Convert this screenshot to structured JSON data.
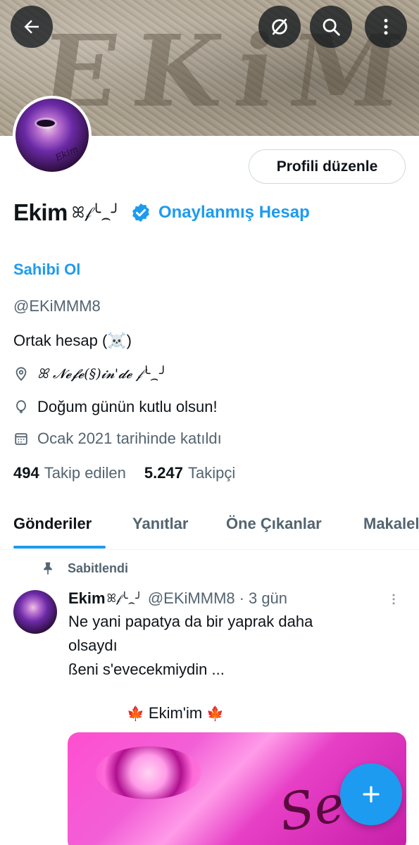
{
  "banner": {
    "text": "EKiM"
  },
  "header_buttons": {
    "back": "back-arrow-icon",
    "grok": "slash-circle-icon",
    "search": "search-icon",
    "more": "more-vertical-icon"
  },
  "profile": {
    "edit_button": "Profili düzenle",
    "name": "Ekim",
    "name_decoration": "ꕤ𝒻╰⁔╯",
    "verified_label": "Onaylanmış Hesap",
    "owner_link": "Sahibi Ol",
    "handle": "@EKiMMM8",
    "bio": "Ortak hesap (☠️)",
    "location": "ꕤ 𝓝𝓮𝓯𝓮(§)𝓲𝓷'𝓭𝓮 𝒻╰⁔╯",
    "birthday": "Doğum günün kutlu olsun!",
    "joined": "Ocak 2021 tarihinde katıldı",
    "following_count": "494",
    "following_label": "Takip edilen",
    "followers_count": "5.247",
    "followers_label": "Takipçi",
    "avatar_signature": "Ekim"
  },
  "tabs": [
    "Gönderiler",
    "Yanıtlar",
    "Öne Çıkanlar",
    "Makaleler"
  ],
  "pinned_label": "Sabitlendi",
  "post": {
    "name": "Ekim",
    "name_decoration": "ꕤ𝒻╰⁔╯",
    "handle": "@EKiMMM8",
    "separator": "·",
    "time": "3 gün",
    "text_line1": "Ne yani papatya da bir yaprak daha",
    "text_line2": "olsaydı",
    "text_line3": "ßeni s'evecekmiydin ...",
    "caption": "Ekim'im",
    "caption_emoji": "🍁",
    "image_text": "Sevi"
  },
  "colors": {
    "accent": "#1d9bf0",
    "text": "#0f1419",
    "secondary": "#536471"
  },
  "fab_icon": "plus-icon"
}
